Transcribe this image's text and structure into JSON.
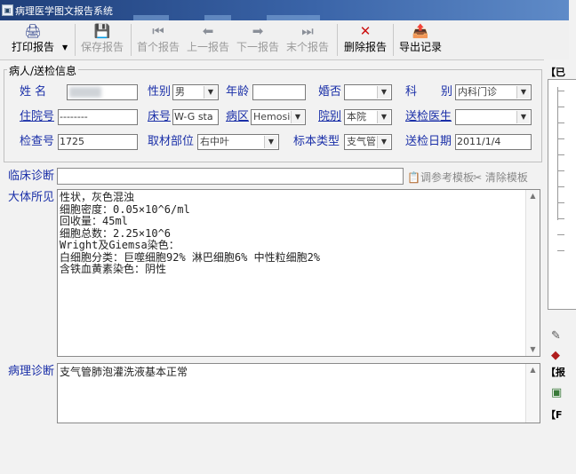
{
  "window": {
    "title": "病理医学图文报告系统",
    "icon": "app-icon"
  },
  "toolbar": {
    "print": "打印报告",
    "save": "保存报告",
    "first": "首个报告",
    "prev": "上一报告",
    "next": "下一报告",
    "last": "末个报告",
    "delete": "删除报告",
    "export": "导出记录"
  },
  "patient": {
    "group_title": "病人/送检信息",
    "name_label": "姓    名",
    "name_value": "",
    "sex_label": "性别",
    "sex_value": "男",
    "age_label": "年龄",
    "age_value": "",
    "married_label": "婚否",
    "married_value": "",
    "dept_label": "科",
    "dept_label2": "别",
    "dept_value": "内科门诊",
    "inpatient_label": "住院号",
    "inpatient_value": "--------",
    "bed_label": "床号",
    "bed_value": "W-G sta",
    "ward_label": "病区",
    "ward_value": "Hemosic",
    "hospital_label": "院别",
    "hospital_value": "本院",
    "doctor_label": "送检医生",
    "doctor_value": "",
    "exam_label": "检查号",
    "exam_value": "1725",
    "site_label": "取材部位",
    "site_value": "右中叶",
    "specimen_label": "标本类型",
    "specimen_value": "支气管",
    "date_label": "送检日期",
    "date_value": "2011/1/4"
  },
  "clinical": {
    "label": "临床诊断",
    "value": "",
    "template_btn": "调参考模板",
    "clear_btn": "清除模板"
  },
  "gross": {
    "label": "大体所见",
    "lines": [
      "性状，灰色混浊",
      "细胞密度：0.05×10^6/ml",
      "回收量：45ml",
      "细胞总数：2.25×10^6",
      "Wright及Giemsa染色：",
      "白细胞分类：巨噬细胞92% 淋巴细胞6% 中性粒细胞2%",
      "含铁血黄素染色：阴性"
    ]
  },
  "pathology": {
    "label": "病理诊断",
    "value": "支气管肺泡灌洗液基本正常"
  },
  "right_panel": {
    "head1": "【已",
    "head2": "【报",
    "head3": "【F"
  }
}
